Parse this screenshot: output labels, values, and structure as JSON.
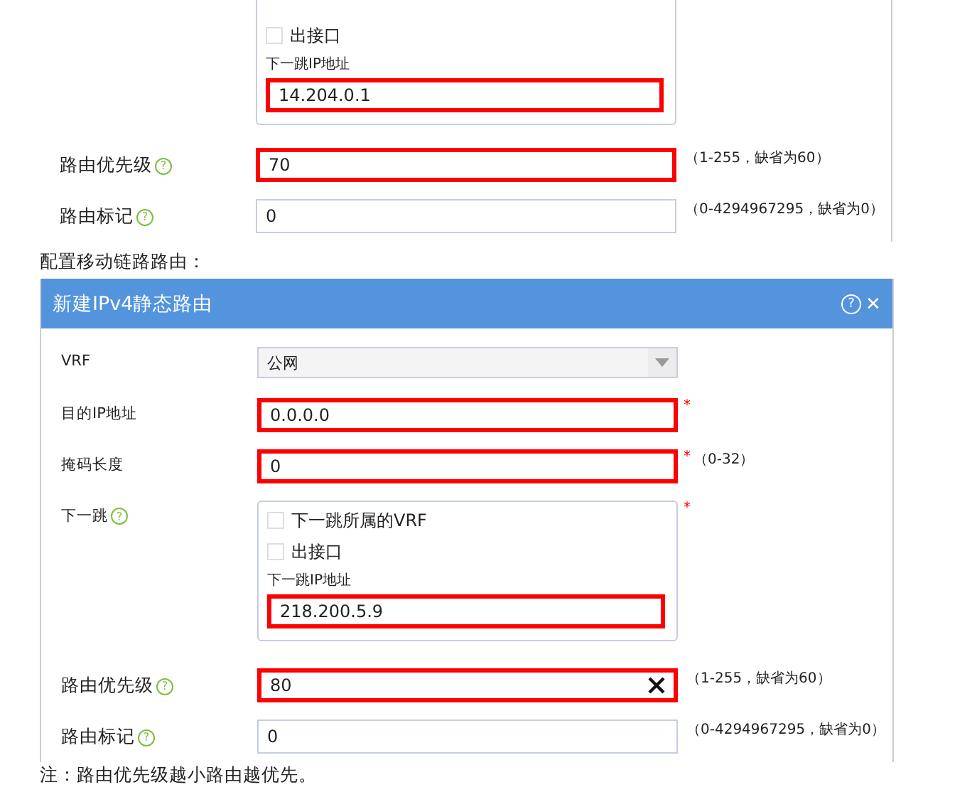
{
  "upper_form": {
    "fields": [
      {
        "kind": "next_hop",
        "options": [
          {
            "label": "出接口",
            "checked": false
          }
        ],
        "ip_label": "下一跳IP地址",
        "ip_value": "14.204.0.1",
        "highlighted": true
      },
      {
        "kind": "text",
        "label": "路由优先级",
        "help": "?",
        "value": "70",
        "hint": "（1-255，缺省为60）",
        "highlighted": true
      },
      {
        "kind": "text",
        "label": "路由标记",
        "help": "?",
        "value": "0",
        "hint": "（0-4294967295，缺省为0）",
        "highlighted": false
      }
    ]
  },
  "caption": "配置移动链路路由：",
  "dialog": {
    "title": "新建IPv4静态路由",
    "help": "?",
    "close": "✕",
    "fields": [
      {
        "kind": "select",
        "label": "VRF",
        "value": "公网"
      },
      {
        "kind": "text",
        "label": "目的IP地址",
        "value": "0.0.0.0",
        "required_mark": "*",
        "highlighted": true
      },
      {
        "kind": "text",
        "label": "掩码长度",
        "value": "0",
        "required_mark": "*",
        "hint": "（0-32）",
        "highlighted": true
      },
      {
        "kind": "next_hop",
        "label": "下一跳",
        "help": "?",
        "required_mark": "*",
        "options": [
          {
            "label": "下一跳所属的VRF",
            "checked": false
          },
          {
            "label": "出接口",
            "checked": false
          }
        ],
        "ip_label": "下一跳IP地址",
        "ip_value": "218.200.5.9",
        "highlighted": true
      },
      {
        "kind": "text",
        "label": "路由优先级",
        "help": "?",
        "value": "80",
        "clearable": true,
        "hint": "（1-255，缺省为60）",
        "highlighted": true
      },
      {
        "kind": "text",
        "label": "路由标记",
        "help": "?",
        "value": "0",
        "hint": "（0-4294967295，缺省为0）",
        "highlighted": false
      }
    ]
  },
  "note": "注：路由优先级越小路由越优先。"
}
